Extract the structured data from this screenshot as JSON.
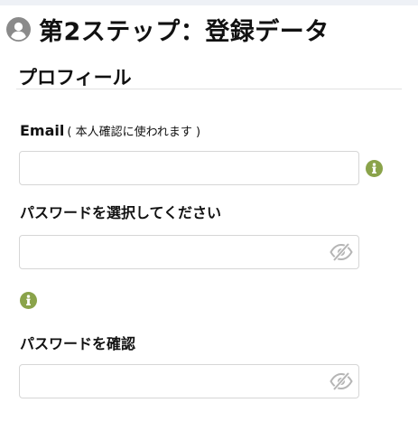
{
  "header": {
    "title": "第2ステップ：登録データ"
  },
  "section": {
    "title": "プロフィール"
  },
  "email": {
    "label": "Email",
    "note": "( 本人確認に使われます )",
    "value": "",
    "placeholder": ""
  },
  "password": {
    "label": "パスワードを選択してください",
    "value": "",
    "placeholder": ""
  },
  "password_confirm": {
    "label": "パスワードを確認",
    "value": "",
    "placeholder": ""
  },
  "icons": {
    "user": "user-circle-icon",
    "info": "info-icon",
    "visibility": "eye-slash-icon"
  },
  "colors": {
    "info_green": "#8aa34a",
    "icon_gray": "#8a8a8a",
    "eye_gray": "#b5b5b5"
  }
}
